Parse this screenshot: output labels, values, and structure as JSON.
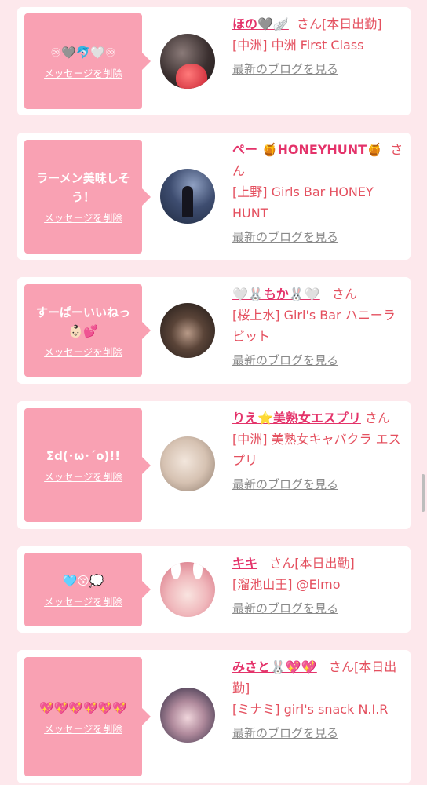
{
  "entries": [
    {
      "message": "♾🩶🐬🤍♾",
      "delete_label": "メッセージを削除",
      "name": "ほの🩶🪽",
      "suffix": "さん[本日出勤]",
      "shop": "[中洲] 中洲 First Class",
      "blog": "最新のブログを見る",
      "avatar_colors": [
        "#3a2f2f",
        "#d94b4b"
      ]
    },
    {
      "message": "ラーメン美味しそう！",
      "delete_label": "メッセージを削除",
      "name": "ペー 🍯HONEYHUNT🍯",
      "suffix": "さん",
      "shop": "[上野] Girls Bar HONEY HUNT",
      "blog": "最新のブログを見る",
      "avatar_colors": [
        "#2d3a5a",
        "#6b7fa8"
      ]
    },
    {
      "message": "すーぱーいいねっ👶🏻💕",
      "delete_label": "メッセージを削除",
      "name": "🤍🐰もか🐰🤍",
      "suffix": "さん",
      "shop": "[桜上水] Girl's Bar ハニーラビット",
      "blog": "最新のブログを見る",
      "avatar_colors": [
        "#2a2220",
        "#8a6c5c"
      ]
    },
    {
      "message": "Σd(･ω･´o)!!",
      "delete_label": "メッセージを削除",
      "name": "りえ⭐️美熟女エスプリ",
      "suffix": "さん",
      "shop": "[中洲] 美熟女キャバクラ エスプリ",
      "blog": "最新のブログを見る",
      "avatar_colors": [
        "#c9b8a8",
        "#efe4da"
      ]
    },
    {
      "message": "🩵😚💭",
      "delete_label": "メッセージを削除",
      "name": "キキ",
      "suffix": "さん[本日出勤]",
      "shop": "[溜池山王] @Elmo",
      "blog": "最新のブログを見る",
      "avatar_colors": [
        "#e58a96",
        "#f6d2d4"
      ]
    },
    {
      "message": "💖💖💖💖💖💖",
      "delete_label": "メッセージを削除",
      "name": "みさと🐰💖💖",
      "suffix": "さん[本日出勤]",
      "shop": "[ミナミ] girl's snack N.I.R",
      "blog": "最新のブログを見る",
      "avatar_colors": [
        "#2b2a40",
        "#d9b8c4"
      ]
    }
  ]
}
